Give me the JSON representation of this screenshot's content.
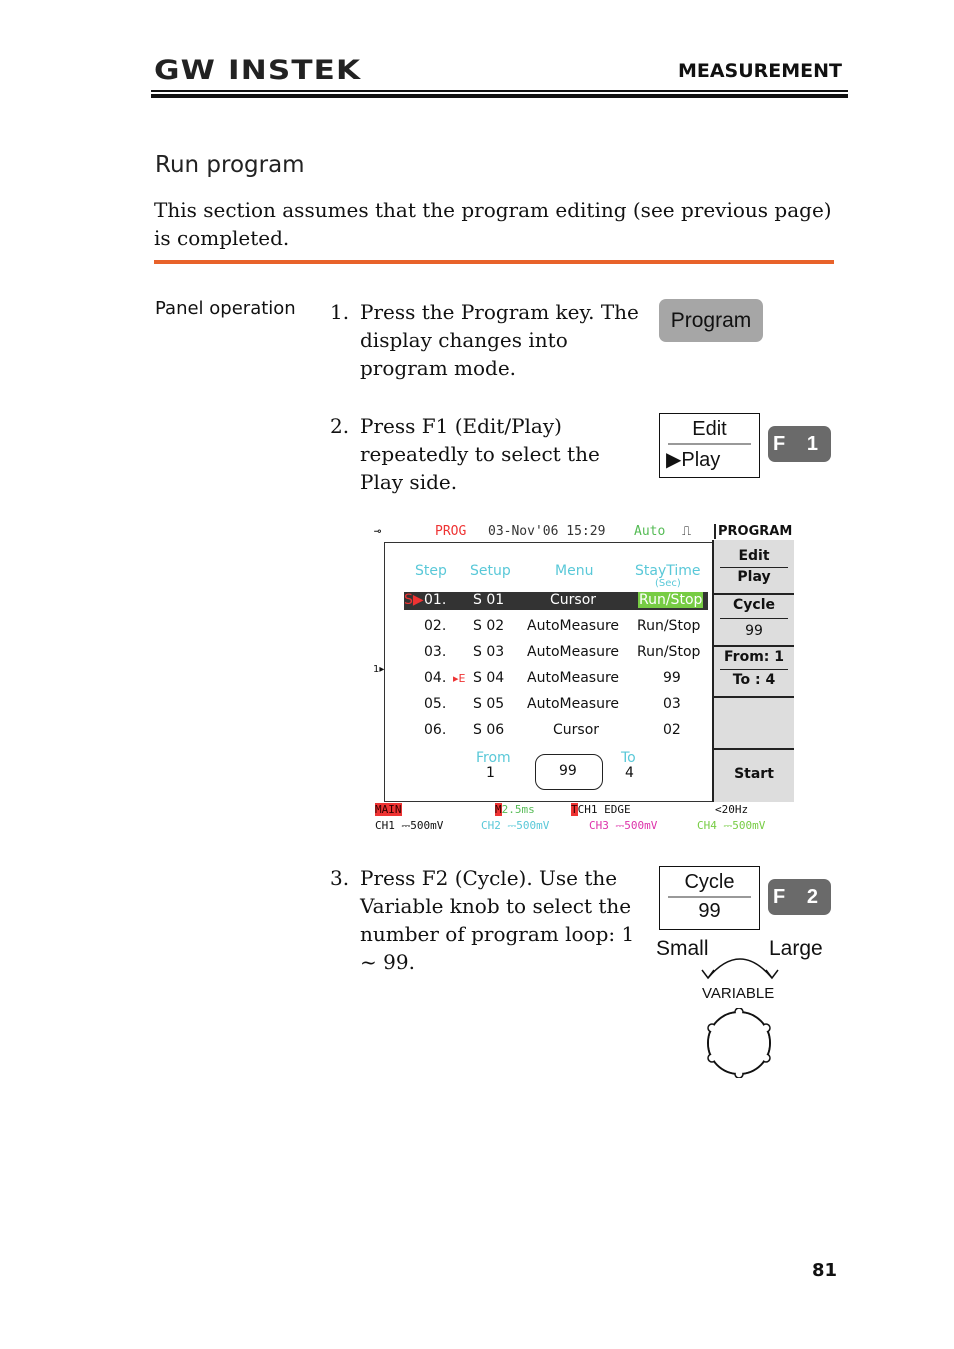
{
  "header": {
    "logo": "GW INSTEK",
    "section": "MEASUREMENT"
  },
  "title": "Run program",
  "intro": "This section assumes that the program editing (see previous page) is completed.",
  "panel_operation_label": "Panel operation",
  "steps": [
    {
      "num": "1.",
      "text": "Press the Program key. The display changes into program mode."
    },
    {
      "num": "2.",
      "text": "Press F1 (Edit/Play) repeatedly to select the Play side."
    },
    {
      "num": "3.",
      "text": "Press F2 (Cycle). Use the Variable knob to select the number of program loop: 1 ~ 99."
    }
  ],
  "keys": {
    "program": "Program",
    "f1": {
      "top": "Edit",
      "bottom": "Play",
      "key": "F 1"
    },
    "f2": {
      "top": "Cycle",
      "bottom": "99",
      "key": "F 2"
    },
    "variable": {
      "small": "Small",
      "large": "Large",
      "label": "VARIABLE"
    }
  },
  "scope": {
    "status": {
      "mode": "PROG",
      "datetime": "03-Nov'06 15:29",
      "trigger_mode": "Auto",
      "menu_title": "PROGRAM"
    },
    "columns": {
      "step": "Step",
      "setup": "Setup",
      "menu": "Menu",
      "staytime": "StayTime",
      "staytime_unit": "(Sec)"
    },
    "rows": [
      {
        "step": "01.",
        "setup": "S 01",
        "menu": "Cursor",
        "stay": "Run/Stop",
        "marker": "S",
        "selected": true
      },
      {
        "step": "02.",
        "setup": "S 02",
        "menu": "AutoMeasure",
        "stay": "Run/Stop",
        "marker": ""
      },
      {
        "step": "03.",
        "setup": "S 03",
        "menu": "AutoMeasure",
        "stay": "Run/Stop",
        "marker": ""
      },
      {
        "step": "04.",
        "setup": "S 04",
        "menu": "AutoMeasure",
        "stay": "99",
        "marker": "E"
      },
      {
        "step": "05.",
        "setup": "S 05",
        "menu": "AutoMeasure",
        "stay": "03",
        "marker": ""
      },
      {
        "step": "06.",
        "setup": "S 06",
        "menu": "Cursor",
        "stay": "02",
        "marker": ""
      }
    ],
    "loop": {
      "from_label": "From",
      "from": "1",
      "count": "99",
      "to_label": "To",
      "to": "4"
    },
    "side_menu": {
      "edit": "Edit",
      "play": "Play",
      "cycle": "Cycle",
      "cycle_val": "99",
      "from": "From: 1",
      "to": "To  : 4",
      "start": "Start"
    },
    "bottom": {
      "main": "MAIN",
      "timebase": "2.5ms",
      "trigger": "CH1  EDGE",
      "freq": "<20Hz",
      "ch1": "CH1 ⎓500mV",
      "ch2": "CH2 ⎓500mV",
      "ch3": "CH3 ⎓500mV",
      "ch4": "CH4 ⎓500mV"
    },
    "ch_marker": "1"
  },
  "page_number": "81"
}
